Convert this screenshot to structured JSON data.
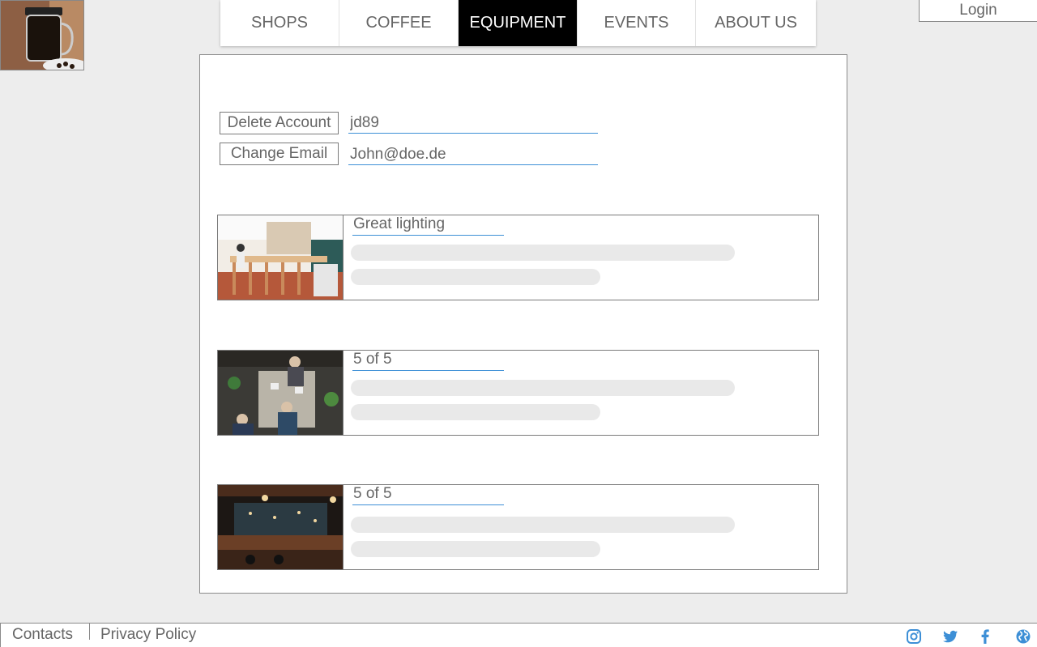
{
  "logo": {
    "icon": "french-press-coffee-photo"
  },
  "nav": {
    "items": [
      {
        "label": "SHOPS",
        "active": false
      },
      {
        "label": "COFFEE",
        "active": false
      },
      {
        "label": "EQUIPMENT",
        "active": true
      },
      {
        "label": "EVENTS",
        "active": false
      },
      {
        "label": "ABOUT US",
        "active": false
      }
    ]
  },
  "header": {
    "login_label": "Login"
  },
  "account": {
    "delete_label": "Delete Account",
    "username": "jd89",
    "change_email_label": "Change Email",
    "email": "John@doe.de"
  },
  "reviews": [
    {
      "title": "Great lighting",
      "image": "bright-cafe-interior-photo"
    },
    {
      "title": "5 of 5",
      "image": "cafe-people-working-photo"
    },
    {
      "title": "5 of 5",
      "image": "dark-bar-interior-photo"
    }
  ],
  "footer": {
    "contacts_label": "Contacts",
    "privacy_label": "Privacy Policy",
    "social": [
      "instagram-icon",
      "twitter-icon",
      "facebook-icon",
      "globe-icon"
    ],
    "social_color": "#3d8fd6"
  },
  "colors": {
    "accent": "#3d8fd6",
    "nav_active_bg": "#000000",
    "page_bg": "#ededed"
  }
}
